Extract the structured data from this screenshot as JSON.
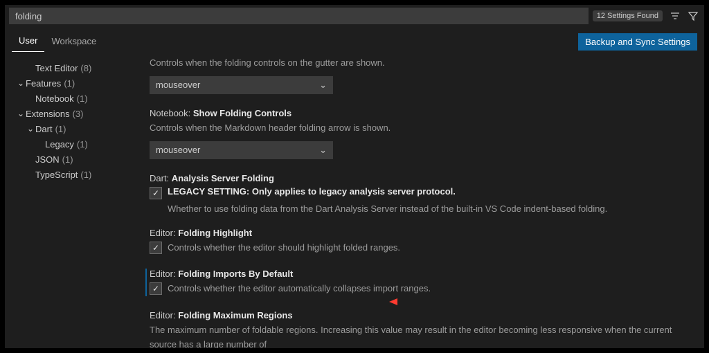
{
  "search": {
    "value": "folding",
    "found_badge": "12 Settings Found"
  },
  "tabs": {
    "user": "User",
    "workspace": "Workspace"
  },
  "sync_button": "Backup and Sync Settings",
  "sidebar": {
    "items": [
      {
        "label": "Text Editor",
        "count": "(8)",
        "indent": 1,
        "chev": ""
      },
      {
        "label": "Features",
        "count": "(1)",
        "indent": 0,
        "chev": "⌄"
      },
      {
        "label": "Notebook",
        "count": "(1)",
        "indent": 1,
        "chev": ""
      },
      {
        "label": "Extensions",
        "count": "(3)",
        "indent": 0,
        "chev": "⌄"
      },
      {
        "label": "Dart",
        "count": "(1)",
        "indent": 1,
        "chev": "⌄"
      },
      {
        "label": "Legacy",
        "count": "(1)",
        "indent": 2,
        "chev": ""
      },
      {
        "label": "JSON",
        "count": "(1)",
        "indent": 1,
        "chev": ""
      },
      {
        "label": "TypeScript",
        "count": "(1)",
        "indent": 1,
        "chev": ""
      }
    ]
  },
  "settings": {
    "s0": {
      "desc": "Controls when the folding controls on the gutter are shown.",
      "value": "mouseover"
    },
    "s1": {
      "scope": "Notebook:",
      "name": "Show Folding Controls",
      "desc": "Controls when the Markdown header folding arrow is shown.",
      "value": "mouseover"
    },
    "s2": {
      "scope": "Dart:",
      "name": "Analysis Server Folding",
      "chk_label": "LEGACY SETTING: Only applies to legacy analysis server protocol.",
      "desc": "Whether to use folding data from the Dart Analysis Server instead of the built-in VS Code indent-based folding."
    },
    "s3": {
      "scope": "Editor:",
      "name": "Folding Highlight",
      "chk_label": "Controls whether the editor should highlight folded ranges."
    },
    "s4": {
      "scope": "Editor:",
      "name": "Folding Imports By Default",
      "chk_label": "Controls whether the editor automatically collapses import ranges."
    },
    "s5": {
      "scope": "Editor:",
      "name": "Folding Maximum Regions",
      "desc": "The maximum number of foldable regions. Increasing this value may result in the editor becoming less responsive when the current source has a large number of"
    }
  }
}
